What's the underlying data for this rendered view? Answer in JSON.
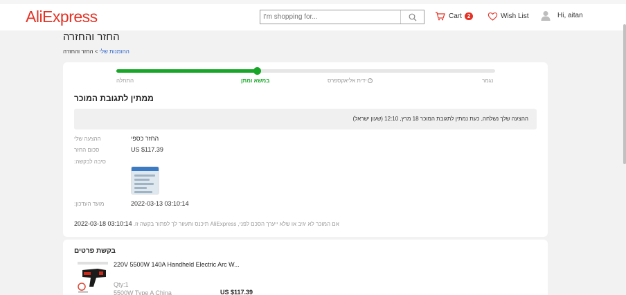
{
  "header": {
    "logo": "AliExpress",
    "search_placeholder": "I'm shopping for...",
    "cart_label": "Cart",
    "cart_count": "2",
    "wishlist_label": "Wish List",
    "user_greeting": "Hi, aitan",
    "brand_color": "#e43225"
  },
  "page": {
    "title": "החזר והחזרה",
    "breadcrumb_link": "ההזמנות שלי",
    "breadcrumb_sep": ">",
    "breadcrumb_current": "החזר והחזרה"
  },
  "progress": {
    "steps": [
      "התחלה",
      "במשא ומתן",
      "ידית אליאקספרס",
      "נגמר"
    ],
    "active_step": 1,
    "accent_color": "#17a627"
  },
  "status": {
    "title": "ממתין לתגובת המוכר",
    "notice": "ההצעה שלך נשלחה, כעת נמתין לתגובת המוכר  18 מרץ, 12:10 (שעון ישראל)"
  },
  "details": {
    "offer_label": "ההצעה שלי",
    "offer_value": "החזר כספי",
    "amount_label": "סכום החזר",
    "amount_value": "US $117.39",
    "reason_label": ":סיבה לבקשה",
    "deadline_label": ":מועד העדכון",
    "deadline_value": "2022-03-13 03:10:14"
  },
  "footnote": {
    "text": ".תיכנס ותעזור לך לפתור בקשה זו AliExpress ,אם המוכר לא יגיב או שלא ייערך הסכם לפני",
    "datetime": "2022-03-18 03:10:14"
  },
  "request_details": {
    "title": "בקשת פרטים",
    "product_name": "220V 5500W 140A Handheld Electric Arc W...",
    "qty": "Qty:1",
    "variant": "5500W Type A China",
    "price": "US $117.39"
  }
}
